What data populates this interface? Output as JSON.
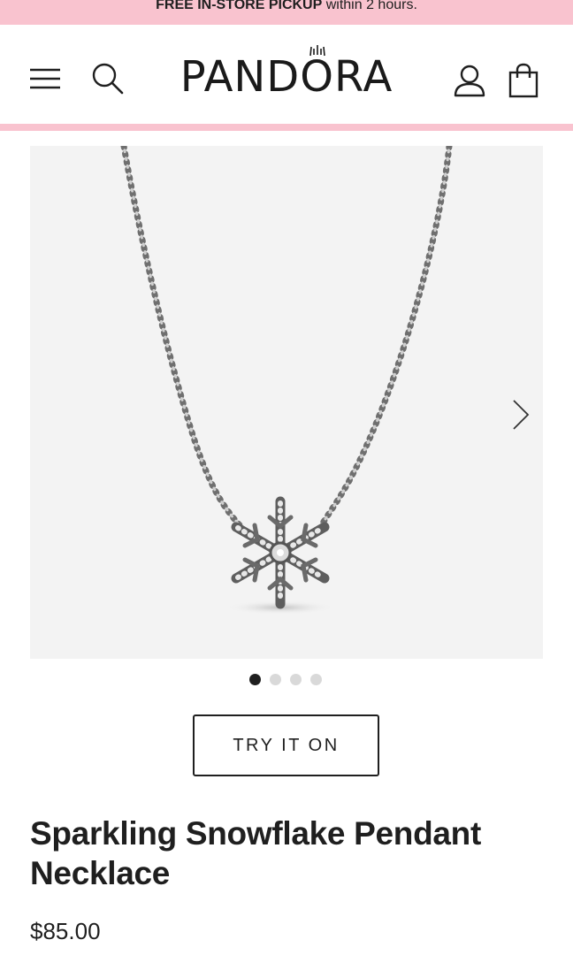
{
  "promo": {
    "bold": "FREE IN-STORE PICKUP",
    "rest": " within 2 hours."
  },
  "header": {
    "brand": "PANDORA",
    "icons": [
      "menu-icon",
      "search-icon",
      "account-icon",
      "bag-icon"
    ]
  },
  "gallery": {
    "slide_count": 4,
    "active_slide": 1,
    "next_icon": "chevron-right-icon"
  },
  "product": {
    "try_on_label": "TRY IT ON",
    "title": "Sparkling Snowflake Pendant Necklace",
    "price": "$85.00"
  },
  "colors": {
    "promo_pink": "#f9c3cf",
    "text": "#1f1f1f",
    "gallery_bg": "#f3f3f3"
  }
}
